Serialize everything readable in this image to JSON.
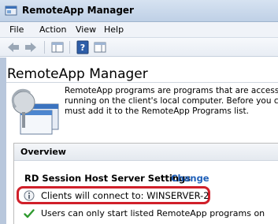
{
  "window": {
    "title": "RemoteApp Manager"
  },
  "menu": {
    "items": [
      "File",
      "Action",
      "View",
      "Help"
    ]
  },
  "toolbar": {
    "buttons": [
      "back-icon",
      "forward-icon",
      "console-tree-icon",
      "help-icon",
      "action-pane-icon"
    ]
  },
  "page": {
    "title": "RemoteApp Manager",
    "description": [
      "RemoteApp programs are programs that are accesse",
      "running on the client's local computer. Before you ca",
      "must add it to the RemoteApp Programs list."
    ]
  },
  "overview": {
    "heading": "Overview",
    "section_title": "RD Session Host Server Settings",
    "change_link": "Change",
    "connect_status": "Clients will connect to: WINSERVER-2",
    "users_status": "Users can only start listed RemoteApp programs on"
  },
  "colors": {
    "highlight": "#d0202a",
    "link": "#1f5fb8"
  }
}
